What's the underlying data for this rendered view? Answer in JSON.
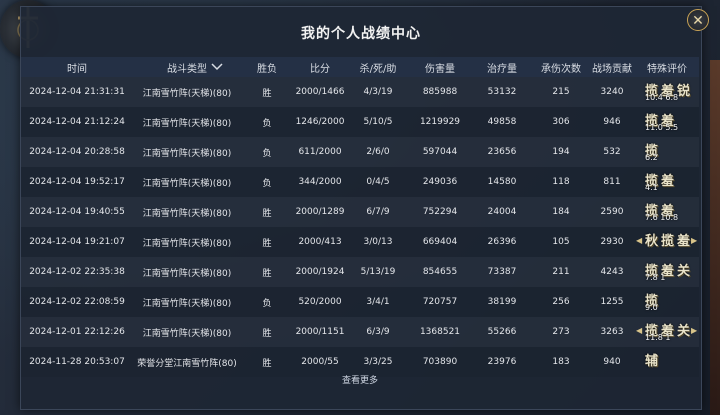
{
  "window": {
    "title": "我的个人战绩中心",
    "close_label": "✕"
  },
  "columns": [
    "时间",
    "战斗类型",
    "胜负",
    "比分",
    "杀/死/助",
    "伤害量",
    "治疗量",
    "承伤次数",
    "战场贡献",
    "特殊评价"
  ],
  "rows": [
    {
      "time": "2024-12-04 21:31:31",
      "type": "江南雪竹阵(天梯)(80)",
      "result": "胜",
      "score": "2000/1466",
      "kda": "4/3/19",
      "damage": "885988",
      "heal": "53132",
      "hits": "215",
      "contrib": "3240",
      "eval": [
        "揽",
        "羞",
        "锐"
      ],
      "eval_num": "10.4 6.8",
      "eval_arrows": false
    },
    {
      "time": "2024-12-04 21:12:24",
      "type": "江南雪竹阵(天梯)(80)",
      "result": "负",
      "score": "1246/2000",
      "kda": "5/10/5",
      "damage": "1219929",
      "heal": "49858",
      "hits": "306",
      "contrib": "946",
      "eval": [
        "揽",
        "羞"
      ],
      "eval_num": "11.0 5.5",
      "eval_arrows": false
    },
    {
      "time": "2024-12-04 20:28:58",
      "type": "江南雪竹阵(天梯)(80)",
      "result": "负",
      "score": "611/2000",
      "kda": "2/6/0",
      "damage": "597044",
      "heal": "23656",
      "hits": "194",
      "contrib": "532",
      "eval": [
        "揽"
      ],
      "eval_num": "6.2",
      "eval_arrows": false
    },
    {
      "time": "2024-12-04 19:52:17",
      "type": "江南雪竹阵(天梯)(80)",
      "result": "负",
      "score": "344/2000",
      "kda": "0/4/5",
      "damage": "249036",
      "heal": "14580",
      "hits": "118",
      "contrib": "811",
      "eval": [
        "揽",
        "羞"
      ],
      "eval_num": "4.1",
      "eval_arrows": false
    },
    {
      "time": "2024-12-04 19:40:55",
      "type": "江南雪竹阵(天梯)(80)",
      "result": "胜",
      "score": "2000/1289",
      "kda": "6/7/9",
      "damage": "752294",
      "heal": "24004",
      "hits": "184",
      "contrib": "2590",
      "eval": [
        "揽",
        "羞"
      ],
      "eval_num": "7.6 10.8",
      "eval_arrows": false
    },
    {
      "time": "2024-12-04 19:21:07",
      "type": "江南雪竹阵(天梯)(80)",
      "result": "胜",
      "score": "2000/413",
      "kda": "3/0/13",
      "damage": "669404",
      "heal": "26396",
      "hits": "105",
      "contrib": "2930",
      "eval": [
        "秋",
        "揽",
        "羞"
      ],
      "eval_num": "",
      "eval_arrows": true
    },
    {
      "time": "2024-12-02 22:35:38",
      "type": "江南雪竹阵(天梯)(80)",
      "result": "胜",
      "score": "2000/1924",
      "kda": "5/13/19",
      "damage": "854655",
      "heal": "73387",
      "hits": "211",
      "contrib": "4243",
      "eval": [
        "揽",
        "羞",
        "关"
      ],
      "eval_num": "7.8 1",
      "eval_arrows": false
    },
    {
      "time": "2024-12-02 22:08:59",
      "type": "江南雪竹阵(天梯)(80)",
      "result": "负",
      "score": "520/2000",
      "kda": "3/4/1",
      "damage": "720757",
      "heal": "38199",
      "hits": "256",
      "contrib": "1255",
      "eval": [
        "揽"
      ],
      "eval_num": "9.0",
      "eval_arrows": false
    },
    {
      "time": "2024-12-01 22:12:26",
      "type": "江南雪竹阵(天梯)(80)",
      "result": "胜",
      "score": "2000/1151",
      "kda": "6/3/9",
      "damage": "1368521",
      "heal": "55266",
      "hits": "273",
      "contrib": "3263",
      "eval": [
        "揽",
        "羞",
        "关"
      ],
      "eval_num": "11.8 1",
      "eval_arrows": true
    },
    {
      "time": "2024-11-28 20:53:07",
      "type": "荣誉分堂江南雪竹阵(80)",
      "result": "胜",
      "score": "2000/55",
      "kda": "3/3/25",
      "damage": "703890",
      "heal": "23976",
      "hits": "183",
      "contrib": "940",
      "eval": [
        "辅"
      ],
      "eval_num": "",
      "eval_arrows": false
    }
  ],
  "footer": {
    "more_label": "查看更多"
  },
  "icons": {
    "sort": "chevron-down-icon",
    "close": "close-icon",
    "emblem": "sword-emblem-icon"
  },
  "colors": {
    "panel_bg": "#1e2634",
    "header_bg": "#243045",
    "accent_gold": "#c9a356",
    "text": "#e4e6ea"
  }
}
